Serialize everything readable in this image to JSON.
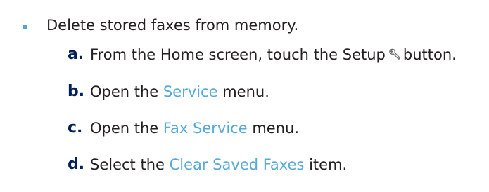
{
  "bullet": {
    "text": "Delete stored faxes from memory."
  },
  "steps": [
    {
      "letter": "a.",
      "text_before": "From the Home screen, touch the Setup",
      "icon": "wrench-icon",
      "text_after": "button."
    },
    {
      "letter": "b.",
      "text_before": "Open the ",
      "highlight": "Service",
      "text_after": " menu."
    },
    {
      "letter": "c.",
      "text_before": "Open the ",
      "highlight": "Fax Service",
      "text_after": " menu."
    },
    {
      "letter": "d.",
      "text_before": "Select the ",
      "highlight": "Clear Saved Faxes",
      "text_after": " item."
    }
  ],
  "colors": {
    "bullet": "#5aa0d8",
    "highlight": "#57a9d9",
    "step_letter": "#00205b",
    "text": "#231f20"
  }
}
